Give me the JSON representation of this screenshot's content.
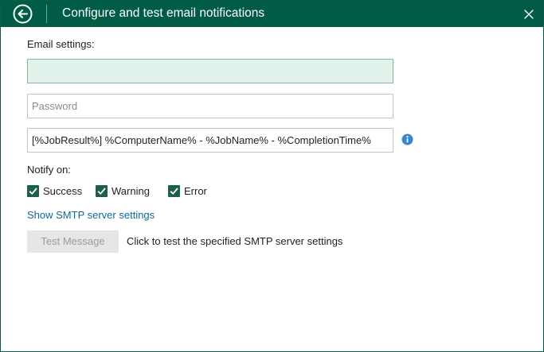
{
  "window": {
    "title": "Configure and test email notifications",
    "back_icon": "back-arrow-circle-icon",
    "close_icon": "close-icon",
    "accent": "#005c45"
  },
  "form": {
    "email_settings_label": "Email settings:",
    "email_value": "",
    "password_placeholder": "Password",
    "subject_value": "[%JobResult%] %ComputerName% - %JobName% - %CompletionTime%",
    "notify_label": "Notify on:",
    "checkboxes": [
      {
        "label": "Success",
        "checked": true
      },
      {
        "label": "Warning",
        "checked": true
      },
      {
        "label": "Error",
        "checked": true
      }
    ],
    "smtp_link": "Show SMTP server settings",
    "test_button": "Test Message",
    "test_hint": "Click to test the specified SMTP server settings"
  }
}
